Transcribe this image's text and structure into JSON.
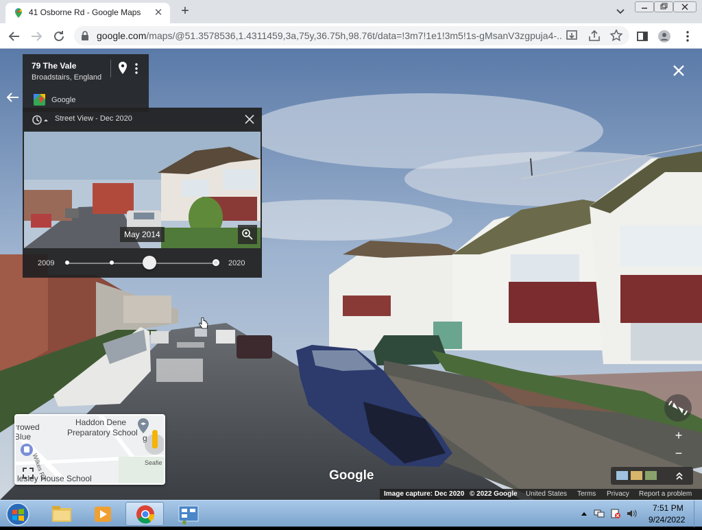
{
  "browser": {
    "tab_title": "41 Osborne Rd - Google Maps",
    "new_tab_symbol": "+",
    "url_main": "google.com",
    "url_rest": "/maps/@51.3578536,1.4311459,3a,75y,36.75h,98.76t/data=!3m7!1e1!3m5!1s-gMsanV3zgpuja4-..."
  },
  "streetview": {
    "address_title": "79 The Vale",
    "address_subtitle": "Broadstairs, England",
    "provider_label": "Google",
    "time_panel_title": "Street View - Dec 2020",
    "thumbnail_date": "May 2014",
    "timeline_start_year": "2009",
    "timeline_end_year": "2020",
    "timeline_selected_fraction": 0.55,
    "watermark": "Google",
    "zoom_in_label": "+",
    "zoom_out_label": "−"
  },
  "minimap": {
    "school_top_line1": "Haddon Dene",
    "school_top_line2": "Preparatory School",
    "left_label_1": "rrowed",
    "left_label_2": "Blue",
    "road_label": "Wilkes Rd",
    "right_label": "Seafie",
    "right_label_2": "g",
    "bottom_label": "lesley House School"
  },
  "attribution": {
    "capture": "Image capture: Dec 2020",
    "copyright": "© 2022 Google",
    "region": "United States",
    "terms": "Terms",
    "privacy": "Privacy",
    "report": "Report a problem"
  },
  "taskbar": {
    "time": "7:51 PM",
    "date": "9/24/2022"
  },
  "colors": {
    "sky": "#6f8fb8",
    "road": "#4a4f55",
    "panel": "#222222",
    "taskbar": "#8fb3d9"
  }
}
